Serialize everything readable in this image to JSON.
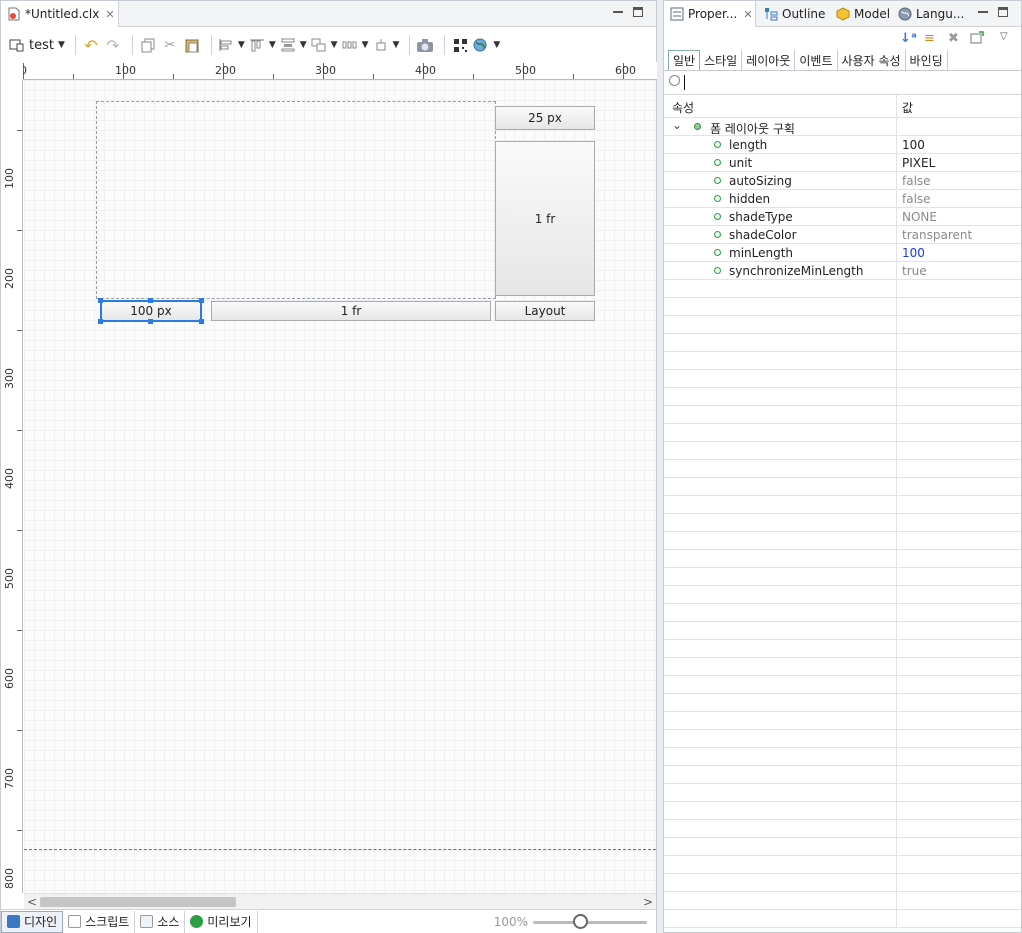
{
  "editor": {
    "tab_title": "*Untitled.clx",
    "toolbar": {
      "device_label": "test"
    },
    "ruler_h": [
      "0",
      "100",
      "200",
      "300",
      "400",
      "500",
      "600"
    ],
    "ruler_v": [
      "100",
      "200",
      "300",
      "400",
      "500",
      "600",
      "700",
      "800"
    ],
    "layout": {
      "cell_top_right": "25 px",
      "cell_mid_right": "1 fr",
      "cell_bottom_1": "100 px",
      "cell_bottom_2": "1 fr",
      "cell_bottom_3": "Layout"
    },
    "bottom_tabs": [
      "디자인",
      "스크립트",
      "소스",
      "미리보기"
    ],
    "zoom": "100%",
    "zoom_level_percent": 100
  },
  "props": {
    "tabs": [
      "Proper...",
      "Outline",
      "Model",
      "Langu..."
    ],
    "subtabs": [
      "일반",
      "스타일",
      "레이아웃",
      "이벤트",
      "사용자 속성",
      "바인딩"
    ],
    "columns": {
      "name": "속성",
      "value": "값"
    },
    "group": "폼 레이아웃 구획",
    "rows": [
      {
        "name": "length",
        "value": "100"
      },
      {
        "name": "unit",
        "value": "PIXEL"
      },
      {
        "name": "autoSizing",
        "value": "false"
      },
      {
        "name": "hidden",
        "value": "false"
      },
      {
        "name": "shadeType",
        "value": "NONE"
      },
      {
        "name": "shadeColor",
        "value": "transparent"
      },
      {
        "name": "minLength",
        "value": "100"
      },
      {
        "name": "synchronizeMinLength",
        "value": "true"
      }
    ],
    "value_colors": [
      "#222222",
      "#222222",
      "#8a8a8a",
      "#8a8a8a",
      "#8a8a8a",
      "#8a8a8a",
      "#1a3fd6",
      "#8a8a8a"
    ]
  },
  "colors": {
    "accent": "#2c7be5",
    "dot": "#2f9e4a"
  }
}
